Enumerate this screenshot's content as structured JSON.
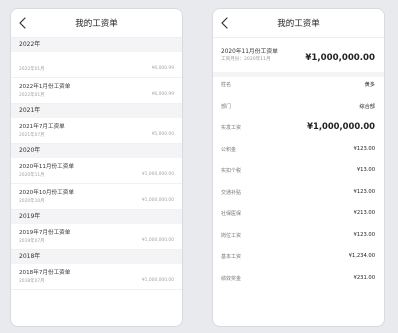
{
  "left_screen": {
    "nav_title": "我的工资单",
    "groups": [
      {
        "year": "2022年",
        "items": [
          {
            "name": "",
            "date": "2022年01月",
            "amount": "¥6,000.99"
          },
          {
            "name": "2022年1月份工资单",
            "date": "2022年01月",
            "amount": "¥6,000.99"
          }
        ]
      },
      {
        "year": "2021年",
        "items": [
          {
            "name": "2021年7月工资单",
            "date": "2021年07月",
            "amount": "¥5,000.00"
          }
        ]
      },
      {
        "year": "2020年",
        "items": [
          {
            "name": "2020年11月份工资单",
            "date": "2020年11月",
            "amount": "¥1,000,000.00"
          },
          {
            "name": "2020年10月份工资单",
            "date": "2020年10月",
            "amount": "¥1,000,000.00"
          }
        ]
      },
      {
        "year": "2019年",
        "items": [
          {
            "name": "2019年7月份工资单",
            "date": "2019年07月",
            "amount": "¥1,000,000.00"
          }
        ]
      },
      {
        "year": "2018年",
        "items": [
          {
            "name": "2018年7月份工资单",
            "date": "2018年07月",
            "amount": "¥1,000,000.00"
          }
        ]
      }
    ]
  },
  "right_screen": {
    "nav_title": "我的工资单",
    "summary": {
      "title": "2020年11月份工资单",
      "date": "工资月份：2020年11月",
      "amount": "¥1,000,000.00"
    },
    "rows": [
      {
        "label": "姓名",
        "value": "黄多",
        "big": false
      },
      {
        "label": "部门",
        "value": "综合部",
        "big": false
      },
      {
        "label": "实发工资",
        "value": "¥1,000,000.00",
        "big": true
      },
      {
        "label": "公积金",
        "value": "¥123.00",
        "big": false
      },
      {
        "label": "实扣个税",
        "value": "¥13.00",
        "big": false
      },
      {
        "label": "交通补贴",
        "value": "¥123.00",
        "big": false
      },
      {
        "label": "社保医保",
        "value": "¥213.00",
        "big": false
      },
      {
        "label": "岗位工资",
        "value": "¥123.00",
        "big": false
      },
      {
        "label": "基本工资",
        "value": "¥1,234.00",
        "big": false
      },
      {
        "label": "绩效奖金",
        "value": "¥231.00",
        "big": false
      }
    ]
  },
  "icons": {
    "back": "chevron-left-icon"
  }
}
